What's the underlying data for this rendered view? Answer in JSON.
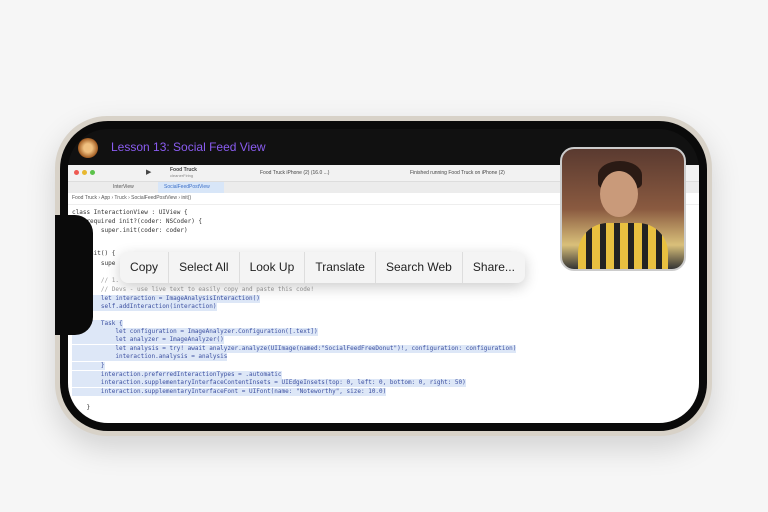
{
  "lesson_title": "Lesson 13: Social Feed View",
  "xcode": {
    "scheme": "Food Truck",
    "scheme_sub": "cleanerFiring",
    "destination": "Food Truck  iPhone (2) (16.0 ...)",
    "status": "Finished running Food Truck on iPhone (2)",
    "tabs": [
      "InterView",
      "SocialFeedPostView"
    ],
    "breadcrumb": "Food Truck › App › Truck › SocialFeedPostView › init()"
  },
  "code_lines": [
    "class InteractionView : UIView {",
    "    required init?(coder: NSCoder) {",
    "        super.init(coder: coder)",
    "    init() {",
    "        supe",
    "        // 1.",
    "        // Devs - use live text to easily copy and paste this code!",
    "        let interaction = ImageAnalysisInteraction()",
    "        self.addInteraction(interaction)",
    "        Task {",
    "            let configuration = ImageAnalyzer.Configuration([.text])",
    "            let analyzer = ImageAnalyzer()",
    "            let analysis = try! await analyzer.analyze(UIImage(named:\"SocialFeedFreeDonut\")!, configuration: configuration)",
    "            interaction.analysis = analysis",
    "        }",
    "        interaction.preferredInteractionTypes = .automatic",
    "        interaction.supplementaryInterfaceContentInsets = UIEdgeInsets(top: 0, left: 0, bottom: 0, right: 50)",
    "        interaction.supplementaryInterfaceFont = UIFont(name: \"Noteworthy\", size: 10.0)",
    "    }"
  ],
  "context_menu": [
    "Copy",
    "Select All",
    "Look Up",
    "Translate",
    "Search Web",
    "Share..."
  ]
}
